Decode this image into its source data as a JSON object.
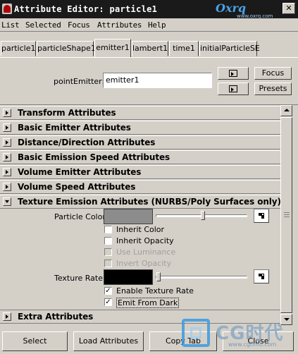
{
  "window": {
    "title": "Attribute Editor: particle1",
    "watermark_top": "Oxrq",
    "watermark_top_sub": "www.oxrq.com"
  },
  "menu": [
    "List",
    "Selected",
    "Focus",
    "Attributes",
    "Help"
  ],
  "tabs": [
    "particle1",
    "particleShape1",
    "emitter1",
    "lambert1",
    "time1",
    "initialParticleSE"
  ],
  "active_tab": "emitter1",
  "node": {
    "label": "pointEmitter:",
    "value": "emitter1"
  },
  "header_buttons": {
    "focus": "Focus",
    "presets": "Presets"
  },
  "sections": [
    {
      "label": "Transform Attributes",
      "expanded": false
    },
    {
      "label": "Basic Emitter Attributes",
      "expanded": false
    },
    {
      "label": "Distance/Direction Attributes",
      "expanded": false
    },
    {
      "label": "Basic Emission Speed Attributes",
      "expanded": false
    },
    {
      "label": "Volume Emitter Attributes",
      "expanded": false
    },
    {
      "label": "Volume Speed Attributes",
      "expanded": false
    },
    {
      "label": "Texture Emission Attributes (NURBS/Poly Surfaces only)",
      "expanded": true
    },
    {
      "label": "Extra Attributes",
      "expanded": false
    }
  ],
  "texture_emission": {
    "particle_color_label": "Particle Color",
    "particle_color": "#8c8c8c",
    "particle_color_slider": 0.5,
    "inherit_color": {
      "label": "Inherit Color",
      "checked": false,
      "enabled": true
    },
    "inherit_opacity": {
      "label": "Inherit Opacity",
      "checked": false,
      "enabled": true
    },
    "use_luminance": {
      "label": "Use Luminance",
      "checked": false,
      "enabled": false
    },
    "invert_opacity": {
      "label": "Invert Opacity",
      "checked": false,
      "enabled": false
    },
    "texture_rate_label": "Texture Rate",
    "texture_rate_color": "#000000",
    "texture_rate_slider": 0.0,
    "enable_texture_rate": {
      "label": "Enable Texture Rate",
      "checked": true,
      "enabled": true
    },
    "emit_from_dark": {
      "label": "Emit From Dark",
      "checked": true,
      "enabled": true
    }
  },
  "bottom_buttons": [
    "Select",
    "Load Attributes",
    "Copy Tab",
    "Close"
  ],
  "watermark_bottom": {
    "text": "CG时代",
    "url": "www.cgtimo.com"
  }
}
